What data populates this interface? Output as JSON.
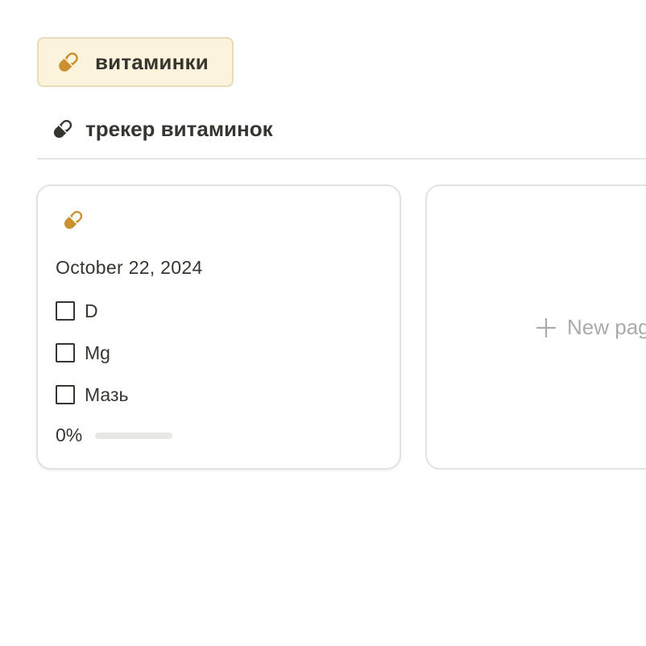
{
  "tag": {
    "label": "витаминки",
    "icon": "pill-icon",
    "icon_color": "#cb912f",
    "background": "#fbf3db"
  },
  "view_tab": {
    "label": "трекер витаминок",
    "icon": "pill-icon"
  },
  "cards": [
    {
      "icon": "pill-icon",
      "date": "October 22, 2024",
      "checklist": [
        {
          "label": "D",
          "checked": false
        },
        {
          "label": "Mg",
          "checked": false
        },
        {
          "label": "Мазь",
          "checked": false
        }
      ],
      "progress": {
        "text": "0%",
        "value": 0
      }
    }
  ],
  "new_page": {
    "label": "New page",
    "icon": "plus-icon"
  },
  "colors": {
    "text": "#37352f",
    "muted": "#acaba9",
    "border": "#e3e2e0",
    "accent": "#cb912f"
  }
}
